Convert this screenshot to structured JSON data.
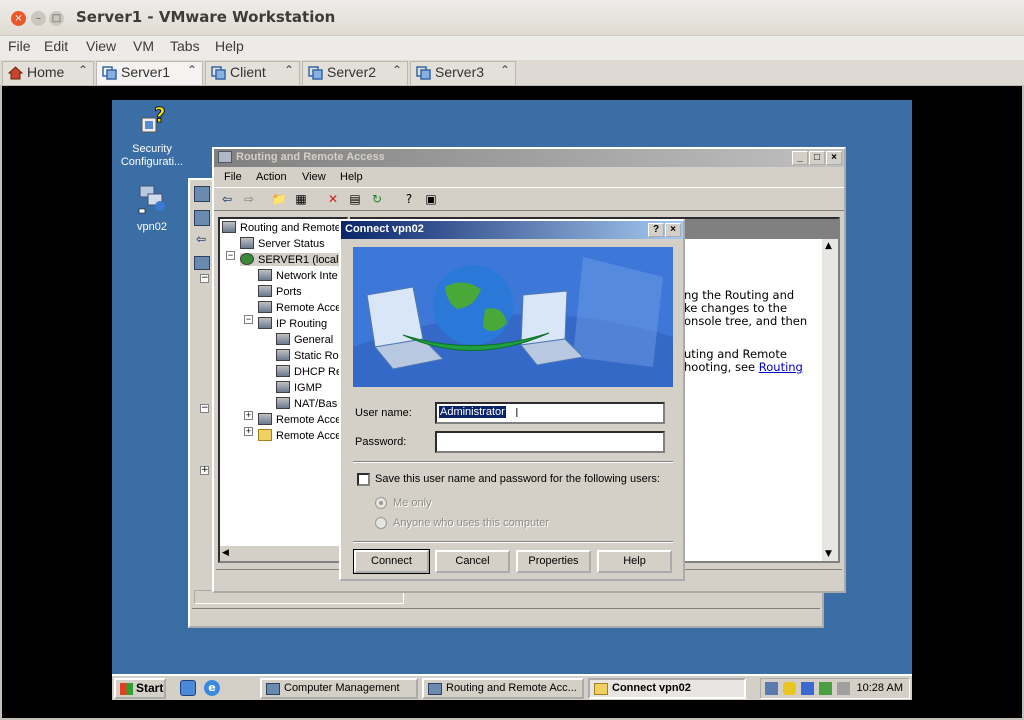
{
  "host": {
    "title": "Server1 - VMware Workstation",
    "menu": [
      "File",
      "Edit",
      "View",
      "VM",
      "Tabs",
      "Help"
    ],
    "tabs": [
      {
        "label": "Home",
        "active": false
      },
      {
        "label": "Server1",
        "active": true
      },
      {
        "label": "Client",
        "active": false
      },
      {
        "label": "Server2",
        "active": false
      },
      {
        "label": "Server3",
        "active": false
      }
    ]
  },
  "desktop_icons": [
    {
      "label": "Security Configurati...",
      "icon": "security-config-icon"
    },
    {
      "label": "vpn02",
      "icon": "network-connection-icon"
    }
  ],
  "rras": {
    "title": "Routing and Remote Access",
    "menu": [
      "File",
      "Action",
      "View",
      "Help"
    ],
    "tree": [
      "Routing and Remote",
      "Server Status",
      "SERVER1 (local)",
      "Network Inte",
      "Ports",
      "Remote Acce",
      "IP Routing",
      "General",
      "Static Ro",
      "DHCP Re",
      "IGMP",
      "NAT/Bas",
      "Remote Acce",
      "Remote Acce"
    ],
    "detail_lines": [
      "ng the Routing and",
      "ke changes to the",
      "onsole tree, and then",
      "uting and Remote",
      "hooting, see"
    ],
    "detail_link": "Routing"
  },
  "dialog": {
    "title": "Connect vpn02",
    "help_btn": "?",
    "close_btn": "×",
    "username_label": "User name:",
    "username_value": "Administrator",
    "password_label": "Password:",
    "save_label": "Save this user name and password for the following users:",
    "radio_me": "Me only",
    "radio_anyone": "Anyone who uses this computer",
    "buttons": {
      "connect": "Connect",
      "cancel": "Cancel",
      "properties": "Properties",
      "help": "Help"
    }
  },
  "taskbar": {
    "start": "Start",
    "items": [
      "Computer Management",
      "Routing and Remote Acc...",
      "Connect vpn02"
    ],
    "clock": "10:28 AM"
  }
}
